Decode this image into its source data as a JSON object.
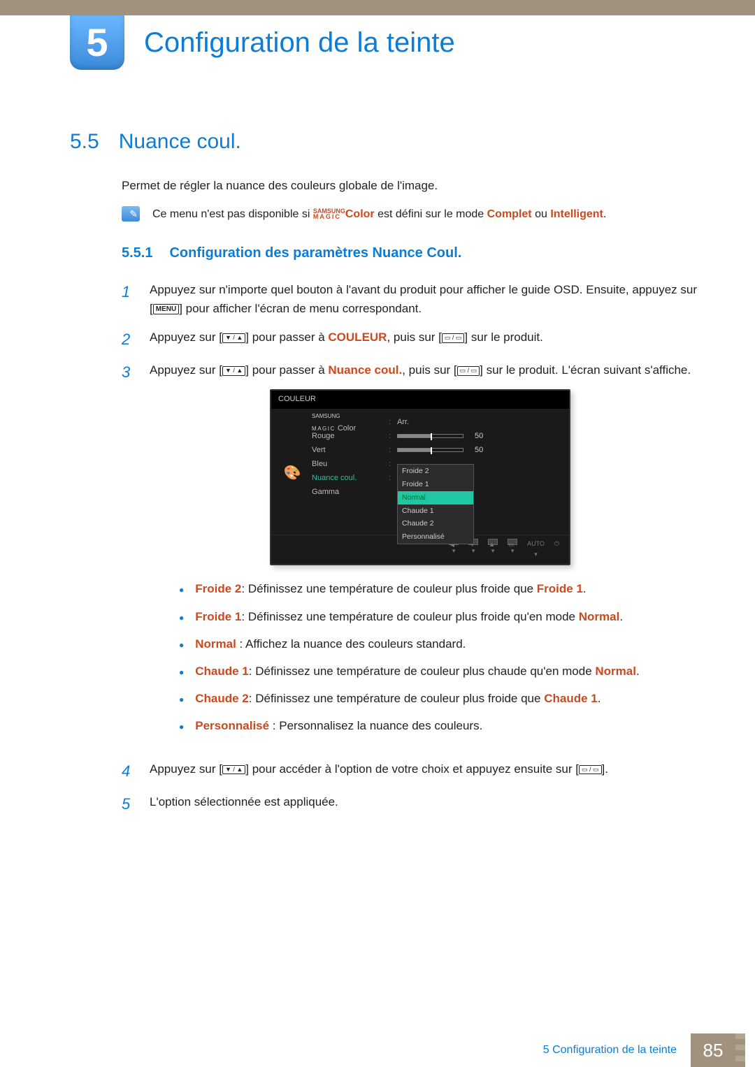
{
  "chapter": {
    "number": "5",
    "title": "Configuration de la teinte"
  },
  "section": {
    "number": "5.5",
    "title": "Nuance coul."
  },
  "intro": "Permet de régler la nuance des couleurs globale de l'image.",
  "note": {
    "pre": "Ce menu n'est pas disponible si ",
    "magic_color_suffix": "Color",
    "mid": " est défini sur le mode ",
    "complet": "Complet",
    "ou": " ou ",
    "intelligent": "Intelligent",
    "end": "."
  },
  "subsection": {
    "number": "5.5.1",
    "title": "Configuration des paramètres Nuance Coul."
  },
  "steps": {
    "s1a": "Appuyez sur n'importe quel bouton à l'avant du produit pour afficher le guide OSD. Ensuite, appuyez sur [",
    "s1_menu": "MENU",
    "s1b": "] pour afficher l'écran de menu correspondant.",
    "s2a": "Appuyez sur [",
    "s2_arrows": "▼ / ▲",
    "s2b": "] pour passer à ",
    "s2_target": "COULEUR",
    "s2c": ", puis sur [",
    "s2_combo": "▭ / ▭",
    "s2d": "] sur le produit.",
    "s3a": "Appuyez sur [",
    "s3b": "] pour passer à ",
    "s3_target": "Nuance coul.",
    "s3c": ", puis sur [",
    "s3d": "] sur le produit. L'écran suivant s'affiche.",
    "s4a": "Appuyez sur [",
    "s4b": "] pour accéder à l'option de votre choix et appuyez ensuite sur [",
    "s4c": "].",
    "s5": "L'option sélectionnée est appliquée."
  },
  "osd": {
    "title": "COULEUR",
    "rows": {
      "magic_suffix": "Color",
      "magic_val": "Arr.",
      "rouge": "Rouge",
      "rouge_val": "50",
      "vert": "Vert",
      "vert_val": "50",
      "bleu": "Bleu",
      "nuance": "Nuance coul.",
      "gamma": "Gamma"
    },
    "dropdown": [
      "Froide 2",
      "Froide 1",
      "Normal",
      "Chaude 1",
      "Chaude 2",
      "Personnalisé"
    ],
    "dropdown_selected": "Normal",
    "bottom": {
      "auto": "AUTO"
    }
  },
  "bullets": [
    {
      "term": "Froide 2",
      "text": ": Définissez une température de couleur plus froide que ",
      "ref": "Froide 1",
      "end": "."
    },
    {
      "term": "Froide 1",
      "text": ": Définissez une température de couleur plus froide qu'en mode ",
      "ref": "Normal",
      "end": "."
    },
    {
      "term": "Normal",
      "text": " : Affichez la nuance des couleurs standard.",
      "ref": "",
      "end": ""
    },
    {
      "term": "Chaude 1",
      "text": ": Définissez une température de couleur plus chaude qu'en mode ",
      "ref": "Normal",
      "end": "."
    },
    {
      "term": "Chaude 2",
      "text": ": Définissez une température de couleur plus froide que ",
      "ref": "Chaude 1",
      "end": "."
    },
    {
      "term": "Personnalisé",
      "text": " : Personnalisez la nuance des couleurs.",
      "ref": "",
      "end": ""
    }
  ],
  "footer": {
    "text": "5 Configuration de la teinte",
    "page": "85"
  }
}
